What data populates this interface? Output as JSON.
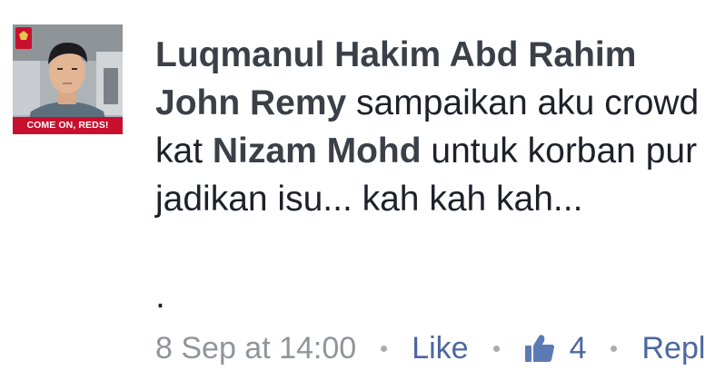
{
  "comment": {
    "author": "Luqmanul Hakim Abd Rahim",
    "avatar_badge": "COME ON, REDS!",
    "line1_mention": "John Remy",
    "line1_text": " sampaikan aku crowd",
    "line2_prefix": "kat ",
    "line2_mention": "Nizam Mohd",
    "line2_text": " untuk korban pur",
    "line3_text": "jadikan isu... kah kah kah...",
    "line4_text": ".",
    "timestamp": "8 Sep at 14:00",
    "like_label": "Like",
    "like_count": "4",
    "reply_label": "Repl"
  },
  "colors": {
    "brand_red": "#c8102e",
    "link_blue": "#4b67a1",
    "meta_grey": "#90949c"
  },
  "icons": {
    "like_count_icon": "thumbs-up-icon"
  }
}
